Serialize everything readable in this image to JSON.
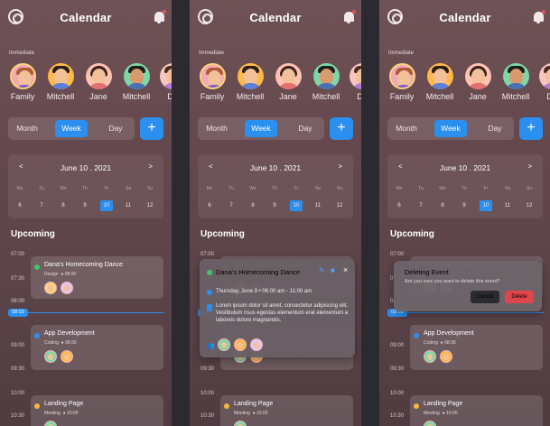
{
  "app_title": "Calendar",
  "group_label": "Immediate",
  "people": [
    {
      "name": "Family",
      "icon": "family-avatar-icon"
    },
    {
      "name": "Mitchell",
      "icon": "man-avatar-icon"
    },
    {
      "name": "Jane",
      "icon": "woman-avatar-icon"
    },
    {
      "name": "Mitchell",
      "icon": "man-avatar-icon"
    },
    {
      "name": "De",
      "icon": "person-avatar-icon"
    }
  ],
  "view_options": [
    "Month",
    "Week",
    "Day"
  ],
  "selected_view": "Week",
  "add_label": "+",
  "calendar": {
    "prev": "<",
    "next": ">",
    "month_label": "June 10 . 2021",
    "weekdays": [
      "Mo",
      "Tu",
      "We",
      "Th",
      "Fr",
      "Sa",
      "Su"
    ],
    "dates": [
      "6",
      "7",
      "8",
      "9",
      "10",
      "11",
      "12"
    ],
    "selected_date": "10"
  },
  "upcoming_label": "Upcoming",
  "times": [
    "07:00",
    "07:30",
    "08:00",
    "08:03",
    "09:00",
    "09:30",
    "10:00",
    "10:30"
  ],
  "current_time": "08:03",
  "events": [
    {
      "title": "Dana's Homecoming Dance",
      "category": "Design",
      "time": "08:00",
      "color": "#3dc46d"
    },
    {
      "title": "App Development",
      "category": "Coding",
      "time": "08:30",
      "color": "#2b8ff0"
    },
    {
      "title": "Landing Page",
      "category": "Meeting",
      "time": "10:00",
      "color": "#f4b63f"
    }
  ],
  "event_detail": {
    "title": "Dana's Homecoming Dance",
    "when": "Thursday, June 9  •  06:00 am - 11:00 am",
    "description": "Lorem ipsum dolor sit amet, consectetur adipiscing elit. Vestibulum risus egestas elementum erat elementum a laboreis dolore magnaretis.",
    "close": "×"
  },
  "delete_dialog": {
    "title": "Deleting Event",
    "message": "Are you sure you want to delete this event?",
    "cancel": "Cancel",
    "delete": "Delete"
  },
  "colors": {
    "accent": "#2b8ff0",
    "danger": "#e0454b",
    "green": "#3dc46d",
    "yellow": "#f4b63f"
  }
}
